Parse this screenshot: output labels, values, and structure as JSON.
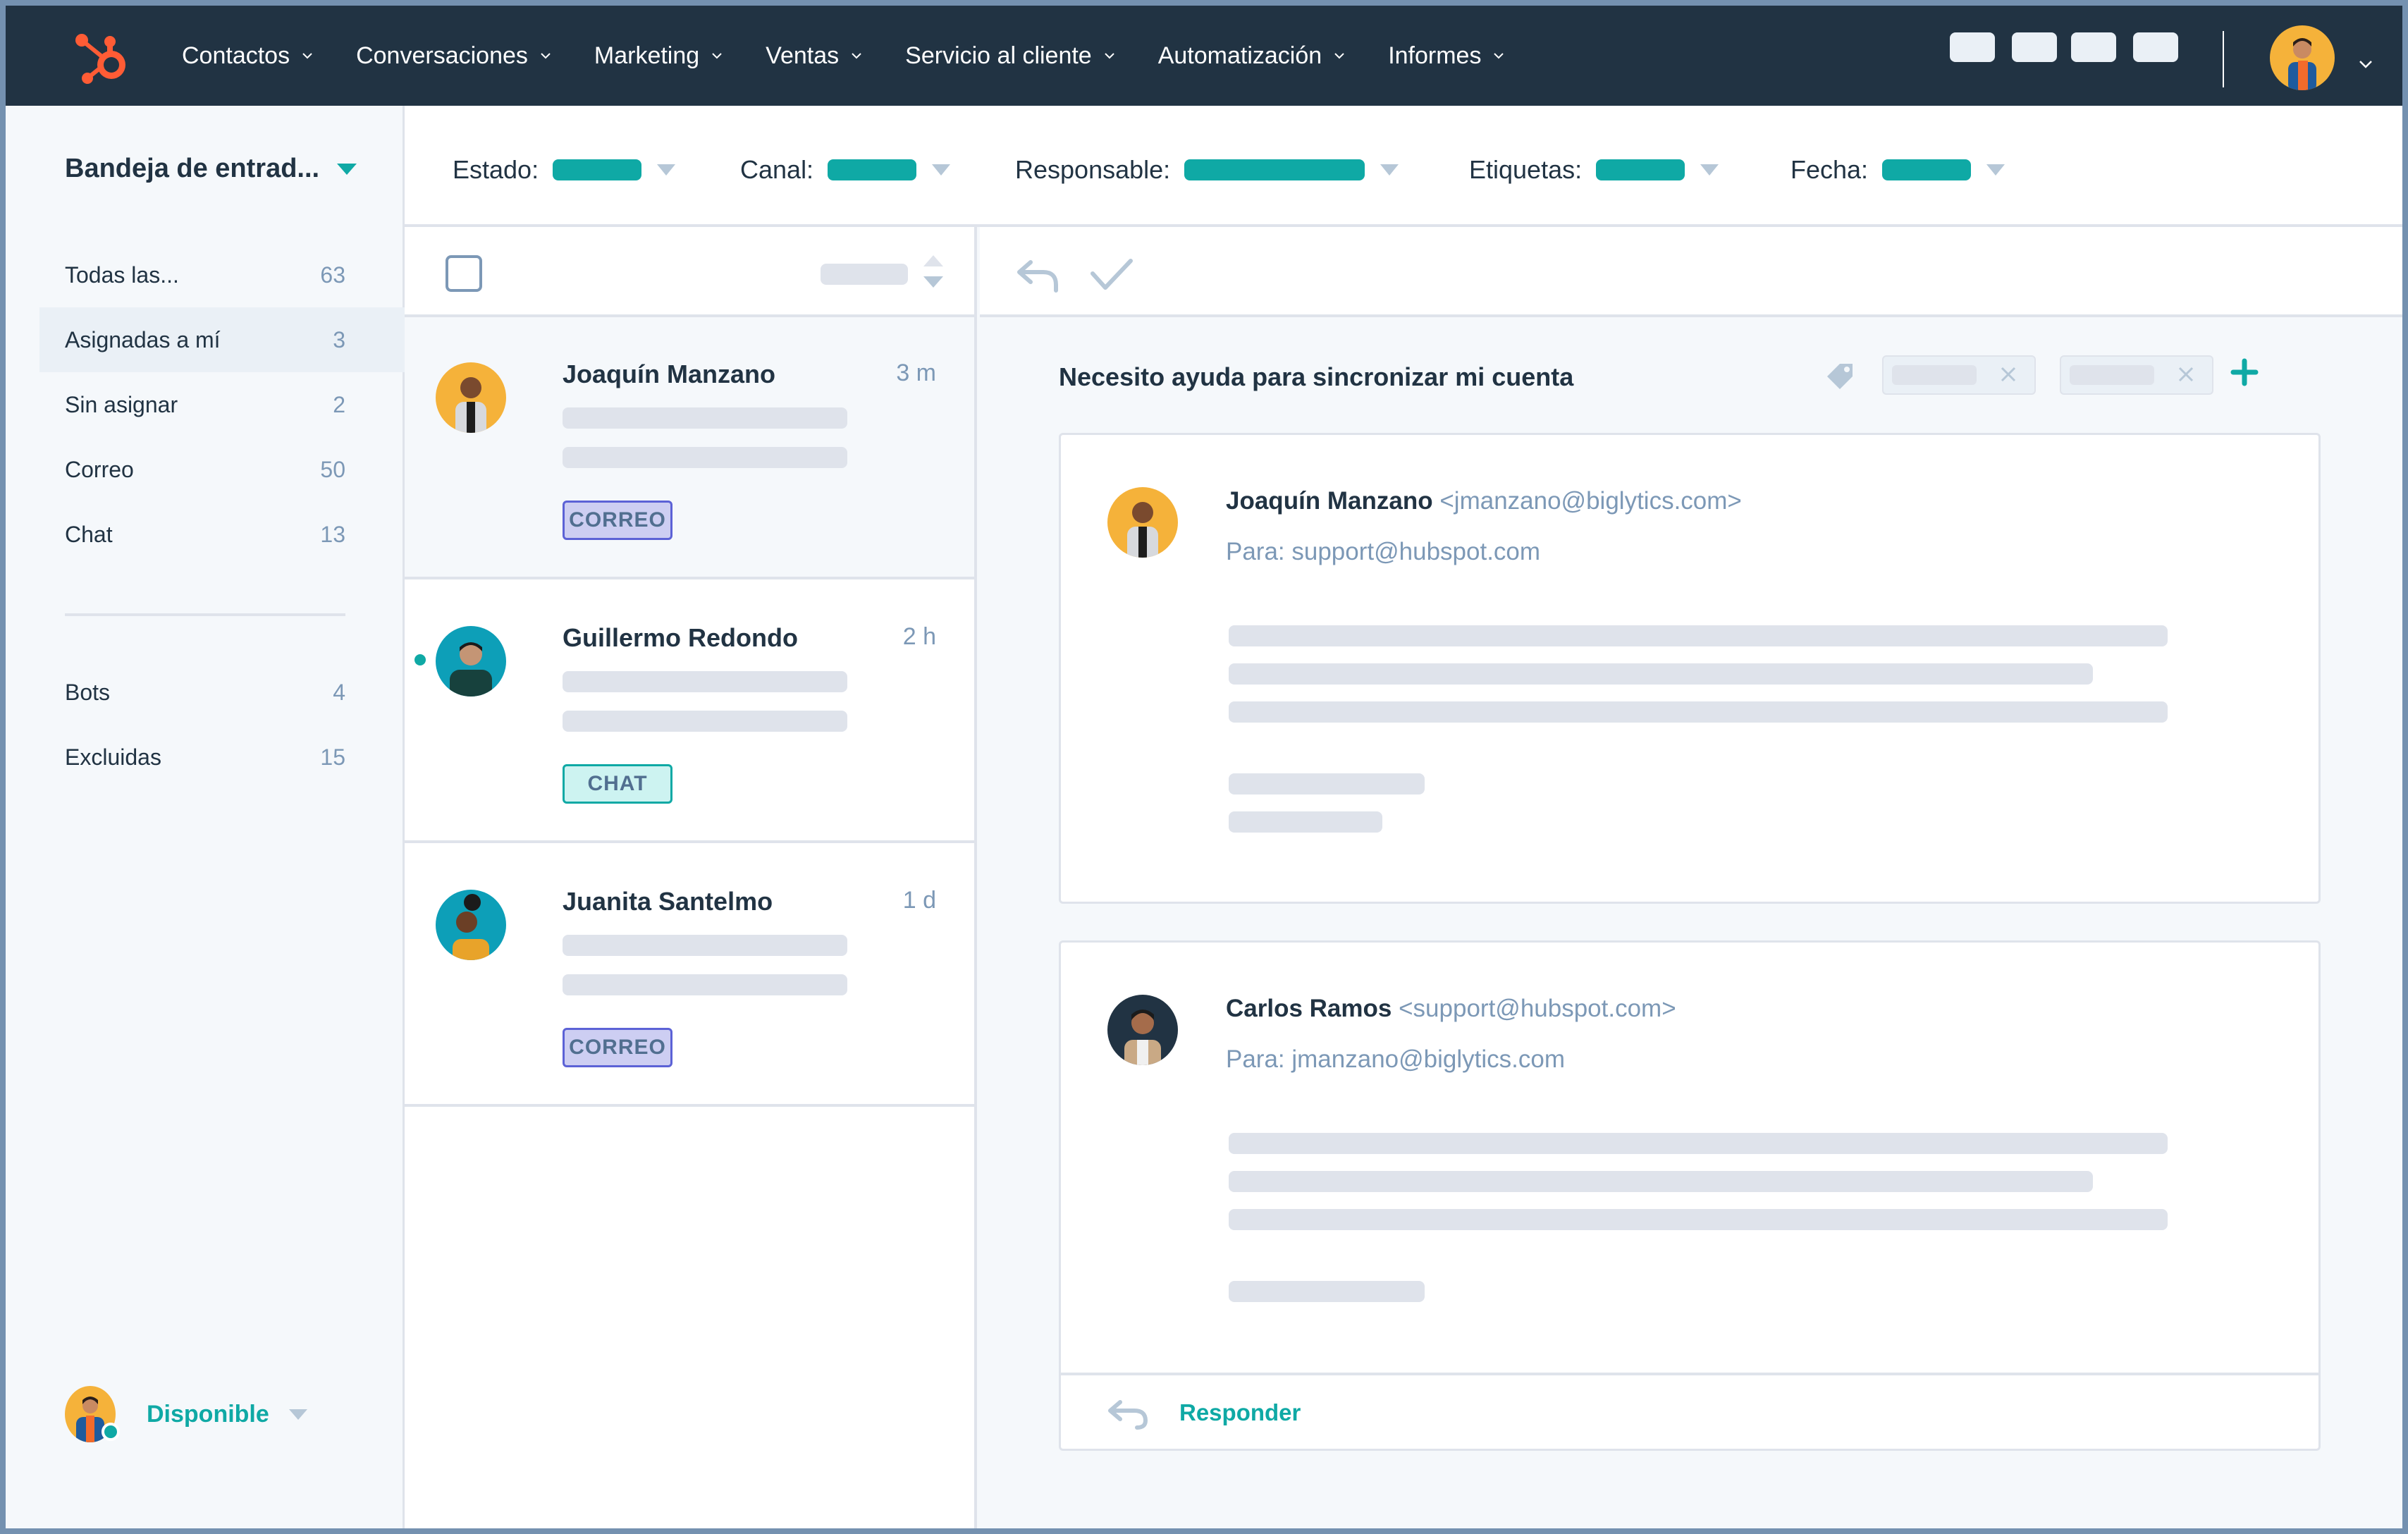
{
  "topnav": {
    "logo": "hubspot-sprocket-logo",
    "items": [
      {
        "label": "Contactos"
      },
      {
        "label": "Conversaciones"
      },
      {
        "label": "Marketing"
      },
      {
        "label": "Ventas"
      },
      {
        "label": "Servicio al cliente"
      },
      {
        "label": "Automatización"
      },
      {
        "label": "Informes"
      }
    ],
    "utility_buttons": 4,
    "account_avatar": "user-avatar-man-blue-jacket"
  },
  "sidebar": {
    "inbox_title": "Bandeja de entrad...",
    "views": [
      {
        "label": "Todas las...",
        "count": "63",
        "active": false
      },
      {
        "label": "Asignadas a mí",
        "count": "3",
        "active": true
      },
      {
        "label": "Sin asignar",
        "count": "2",
        "active": false
      },
      {
        "label": "Correo",
        "count": "50",
        "active": false
      },
      {
        "label": "Chat",
        "count": "13",
        "active": false
      }
    ],
    "secondary_views": [
      {
        "label": "Bots",
        "count": "4"
      },
      {
        "label": "Excluidas",
        "count": "15"
      }
    ],
    "status": {
      "label": "Disponible",
      "indicator": "online"
    }
  },
  "filters": [
    {
      "label": "Estado:"
    },
    {
      "label": "Canal:"
    },
    {
      "label": "Responsable:"
    },
    {
      "label": "Etiquetas:"
    },
    {
      "label": "Fecha:"
    }
  ],
  "conversations": [
    {
      "name": "Joaquín Manzano",
      "time": "3 m",
      "channel": "CORREO",
      "selected": true,
      "unread": false
    },
    {
      "name": "Guillermo Redondo",
      "time": "2 h",
      "channel": "CHAT",
      "selected": false,
      "unread": true
    },
    {
      "name": "Juanita Santelmo",
      "time": "1 d",
      "channel": "CORREO",
      "selected": false,
      "unread": false
    }
  ],
  "thread": {
    "subject": "Necesito ayuda para sincronizar mi cuenta",
    "messages": [
      {
        "sender": "Joaquín Manzano",
        "sender_email": "<jmanzano@biglytics.com>",
        "to": "Para: support@hubspot.com"
      },
      {
        "sender": "Carlos Ramos",
        "sender_email": "<support@hubspot.com>",
        "to": "Para: jmanzano@biglytics.com"
      }
    ],
    "reply_label": "Responder"
  },
  "colors": {
    "nav_bg": "#213343",
    "accent_teal": "#0fa9a5",
    "brand_orange": "#ff5c35",
    "text_dark": "#213343",
    "text_muted": "#7c98b6",
    "skeleton": "#dfe3eb"
  }
}
